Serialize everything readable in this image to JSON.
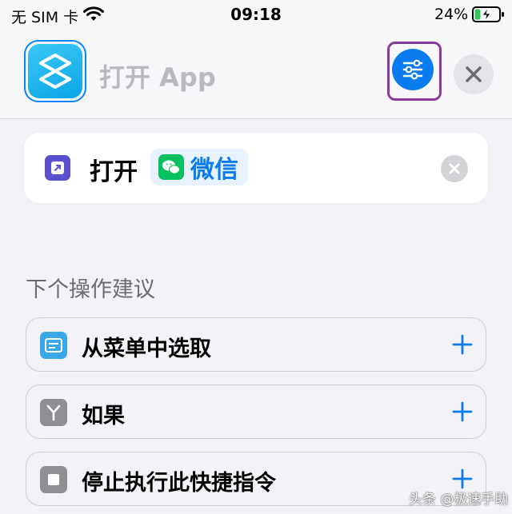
{
  "status_bar": {
    "carrier": "无 SIM 卡",
    "time": "09:18",
    "battery": "24%",
    "battery_level": 0.24,
    "icons": [
      "wifi-icon",
      "battery-charging-icon"
    ]
  },
  "header": {
    "title": "打开 App",
    "app_icon": "shortcuts-icon",
    "settings_icon": "sliders-icon",
    "close_icon": "close-icon"
  },
  "action": {
    "verb": "打开",
    "app_name": "微信",
    "app_icon": "wechat-icon",
    "action_icon": "open-app-icon",
    "clear_icon": "clear-icon"
  },
  "suggestions": {
    "title": "下个操作建议",
    "items": [
      {
        "label": "从菜单中选取",
        "icon": "menu-icon",
        "color": "#3aa8e8"
      },
      {
        "label": "如果",
        "icon": "branch-icon",
        "color": "#8e8e93"
      },
      {
        "label": "停止执行此快捷指令",
        "icon": "stop-icon",
        "color": "#8e8e93"
      }
    ],
    "add_icon": "plus-icon"
  },
  "watermark": "头条 @极速手助",
  "colors": {
    "accent": "#0a7cf0",
    "highlight_frame": "#8a3a9a",
    "wechat": "#07c160",
    "background": "#f2f2f7"
  }
}
